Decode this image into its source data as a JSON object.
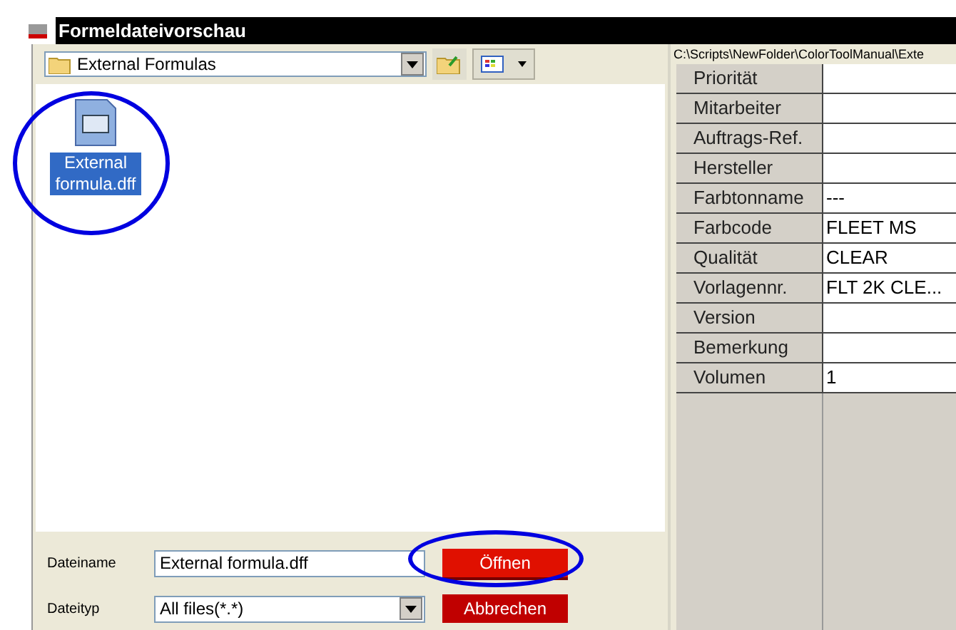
{
  "window": {
    "title": "Formeldateivorschau"
  },
  "folder": {
    "name": "External Formulas"
  },
  "files": [
    {
      "name": "External formula.dff",
      "selected": true
    }
  ],
  "path": "C:\\Scripts\\NewFolder\\ColorToolManual\\Exte",
  "properties": [
    {
      "label": "Priorität"
    },
    {
      "label": "Mitarbeiter"
    },
    {
      "label": "Auftrags-Ref."
    },
    {
      "label": "Hersteller"
    },
    {
      "label": "Farbtonname",
      "value": "---"
    },
    {
      "label": "Farbcode",
      "value": "FLEET MS"
    },
    {
      "label": "Qualität",
      "value": "CLEAR"
    },
    {
      "label": "Vorlagennr.",
      "value": "FLT 2K CLE..."
    },
    {
      "label": "Version"
    },
    {
      "label": "Bemerkung"
    },
    {
      "label": "Volumen",
      "value": "1"
    }
  ],
  "filename": {
    "label": "Dateiname",
    "value": "External formula.dff"
  },
  "filetype": {
    "label": "Dateityp",
    "value": "All files(*.*)"
  },
  "buttons": [
    {
      "label": "Öffnen",
      "highlighted": true
    },
    {
      "label": "Abbrechen",
      "highlighted": false
    }
  ]
}
